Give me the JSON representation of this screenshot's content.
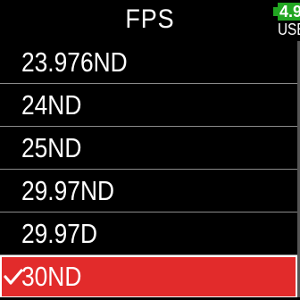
{
  "header": {
    "title": "FPS",
    "battery_level": "4.9",
    "power_source": "USB"
  },
  "list": {
    "items": [
      {
        "label": "23.976ND",
        "selected": false
      },
      {
        "label": "24ND",
        "selected": false
      },
      {
        "label": "25ND",
        "selected": false
      },
      {
        "label": "29.97ND",
        "selected": false
      },
      {
        "label": "29.97D",
        "selected": false
      },
      {
        "label": "30ND",
        "selected": true
      }
    ]
  },
  "colors": {
    "background": "#000000",
    "selected": "#e22b2b",
    "battery": "#21a621"
  },
  "icons": {
    "selected_marker": "checkmark-icon",
    "battery": "battery-icon"
  }
}
